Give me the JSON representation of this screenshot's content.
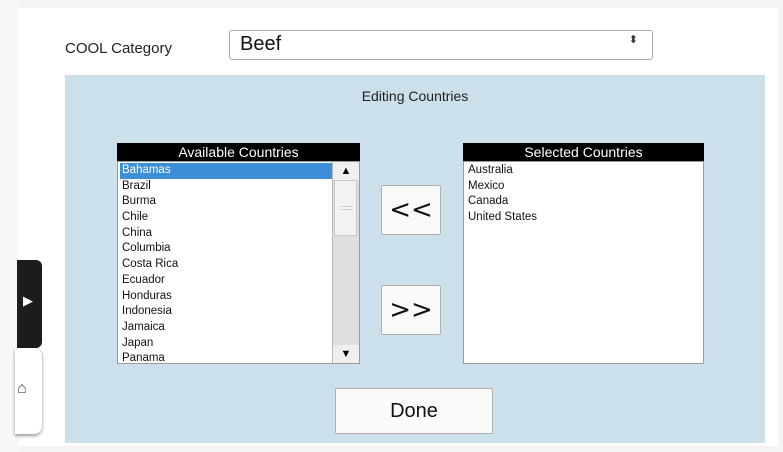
{
  "form": {
    "category_label": "COOL Category",
    "category_value": "Beef",
    "category_arrows": "⬍"
  },
  "panel": {
    "title": "Editing Countries",
    "available_header": "Available Countries",
    "selected_header": "Selected Countries",
    "available_countries": [
      "Bahamas",
      "Brazil",
      "Burma",
      "Chile",
      "China",
      "Columbia",
      "Costa Rica",
      "Ecuador",
      "Honduras",
      "Indonesia",
      "Jamaica",
      "Japan",
      "Panama"
    ],
    "available_selected_index": 0,
    "selected_countries": [
      "Australia",
      "Mexico",
      "Canada",
      "United States"
    ],
    "move_left_label": "<<",
    "move_right_label": ">>",
    "done_label": "Done"
  },
  "colors": {
    "panel_background": "#cbe0ea",
    "selection_highlight": "#3c8ed6",
    "header_background": "#000000"
  },
  "icons": {
    "scroll_up": "triangle-up-icon",
    "scroll_down": "triangle-down-icon",
    "expand": "chevron-right-icon",
    "home": "home-icon"
  }
}
